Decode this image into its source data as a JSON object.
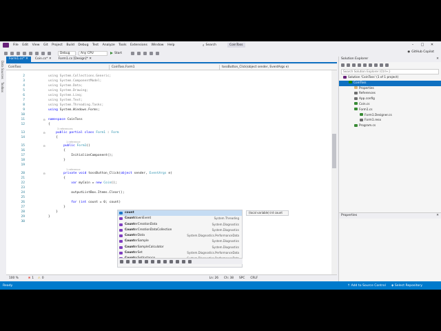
{
  "menu": [
    "File",
    "Edit",
    "View",
    "Git",
    "Project",
    "Build",
    "Debug",
    "Test",
    "Analyze",
    "Tools",
    "Extensions",
    "Window",
    "Help"
  ],
  "search_label": "Search",
  "solution_name": "CoinToss",
  "window_controls": {
    "minimize": "–",
    "maximize": "□",
    "close": "✕"
  },
  "toolbar": {
    "config": "Debug",
    "platform": "Any CPU",
    "start_label": "Start",
    "copilot": "GitHub Copilot"
  },
  "side_strip": [
    "Data Sources",
    "Toolbox"
  ],
  "doc_tabs": [
    {
      "label": "Form1.cs*",
      "active": true
    },
    {
      "label": "Coin.cs*",
      "active": false
    },
    {
      "label": "Form1.cs [Design]*",
      "active": false
    }
  ],
  "navbar": {
    "project": "CoinToss",
    "class": "CoinToss.Form1",
    "member": "tossButton_Click(object sender, EventArgs e)"
  },
  "code": {
    "l2": "using System.Collections.Generic;",
    "l3": "using System.ComponentModel;",
    "l4": "using System.Data;",
    "l5": "using System.Drawing;",
    "l6": "using System.Linq;",
    "l7": "using System.Text;",
    "l8": "using System.Threading.Tasks;",
    "l9": "using System.Windows.Forms;",
    "refs3": "3 references",
    "refs1": "1 reference",
    "refs1b": "1 reference",
    "l16b": "InitializeComponent();",
    "l22": "outputListBox.Items.Clear();"
  },
  "intellisense": {
    "items": [
      {
        "label": "count",
        "ns": "",
        "kind": "var"
      },
      {
        "label": "CountdownEvent",
        "ns": "System.Threading",
        "kind": "class"
      },
      {
        "label": "CounterCreationData",
        "ns": "System.Diagnostics",
        "kind": "class"
      },
      {
        "label": "CounterCreationDataCollection",
        "ns": "System.Diagnostics",
        "kind": "class"
      },
      {
        "label": "CounterData",
        "ns": "System.Diagnostics.PerformanceData",
        "kind": "class"
      },
      {
        "label": "CounterSample",
        "ns": "System.Diagnostics",
        "kind": "class"
      },
      {
        "label": "CounterSampleCalculator",
        "ns": "System.Diagnostics",
        "kind": "class"
      },
      {
        "label": "CounterSet",
        "ns": "System.Diagnostics.PerformanceData",
        "kind": "class"
      },
      {
        "label": "CounterSetInstance",
        "ns": "System.Diagnostics.PerformanceData",
        "kind": "class"
      }
    ],
    "tooltip": "(local variable) int count"
  },
  "editor_status": {
    "zoom": "100 %",
    "errors": "1",
    "warnings": "0",
    "position": "Ln: 26",
    "col": "Ch: 38",
    "spc": "SPC",
    "crlf": "CRLF"
  },
  "status_bar": {
    "ready": "Ready",
    "source_control": "Add to Source Control",
    "repository": "Select Repository"
  },
  "solution_explorer": {
    "title": "Solution Explorer",
    "search_placeholder": "Search Solution Explorer (Ctrl+;)",
    "tree": [
      {
        "label": "Solution 'CoinToss' (1 of 1 project)",
        "indent": 0,
        "sel": false,
        "color": "#68217a"
      },
      {
        "label": "CoinToss",
        "indent": 1,
        "sel": true,
        "color": "#178600"
      },
      {
        "label": "Properties",
        "indent": 2,
        "sel": false,
        "color": "#dcb67a"
      },
      {
        "label": "References",
        "indent": 2,
        "sel": false,
        "color": "#6f6f6f"
      },
      {
        "label": "App.config",
        "indent": 2,
        "sel": false,
        "color": "#6f6f6f"
      },
      {
        "label": "Coin.cs",
        "indent": 2,
        "sel": false,
        "color": "#388a34"
      },
      {
        "label": "Form1.cs",
        "indent": 2,
        "sel": false,
        "color": "#388a34"
      },
      {
        "label": "Form1.Designer.cs",
        "indent": 3,
        "sel": false,
        "color": "#388a34"
      },
      {
        "label": "Form1.resx",
        "indent": 3,
        "sel": false,
        "color": "#6f6f6f"
      },
      {
        "label": "Program.cs",
        "indent": 2,
        "sel": false,
        "color": "#388a34"
      }
    ]
  },
  "properties": {
    "title": "Properties"
  }
}
